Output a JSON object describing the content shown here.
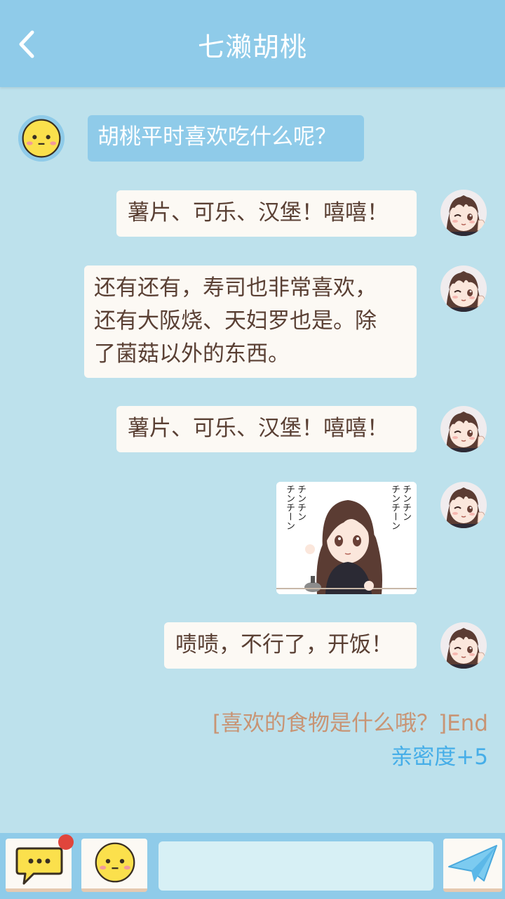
{
  "header": {
    "title": "七濑胡桃"
  },
  "messages": [
    {
      "sender": "user",
      "text": "胡桃平时喜欢吃什么呢？"
    },
    {
      "sender": "character",
      "text": "薯片、可乐、汉堡！嘻嘻！"
    },
    {
      "sender": "character",
      "lines": [
        "还有还有，寿司也非常喜欢，",
        "还有大阪烧、天妇罗也是。除",
        "了菌菇以外的东西。"
      ]
    },
    {
      "sender": "character",
      "text": "薯片、可乐、汉堡！嘻嘻！"
    },
    {
      "sender": "character",
      "sticker": {
        "right_text": "チンチン\nチンチーン",
        "left_text": "チンチン\nチンチーン"
      }
    },
    {
      "sender": "character",
      "text": "啧啧，不行了，开饭！"
    }
  ],
  "event": {
    "topic": "[喜欢的食物是什么哦？]End",
    "bonus": "亲密度+5"
  },
  "input": {
    "value": "",
    "placeholder": ""
  },
  "icons": {
    "back": "chevron-left-icon",
    "chat": "speech-bubble-icon",
    "emoji": "smiley-icon",
    "send": "paper-plane-icon"
  },
  "colors": {
    "header": "#8fcbe9",
    "background": "#bde1ec",
    "bubble_me": "#fcf9f4",
    "bubble_other": "#8fcbe9",
    "event_text": "#c89474",
    "bonus_text": "#46aee8",
    "badge": "#e0453c"
  }
}
